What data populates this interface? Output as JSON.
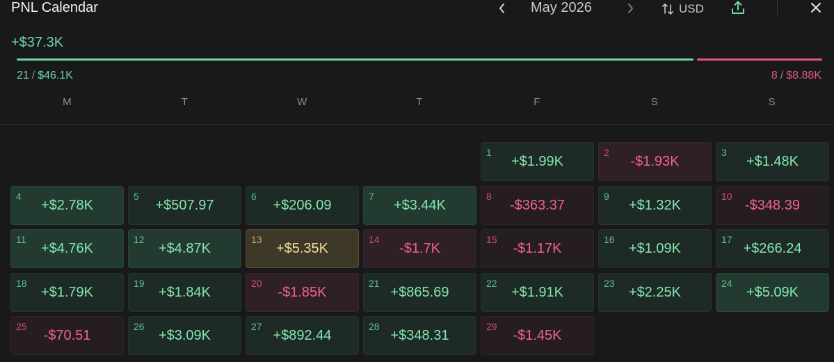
{
  "header": {
    "title": "PNL Calendar",
    "month": "May 2026",
    "currency": "USD"
  },
  "colors": {
    "profit": "#84e6b0",
    "loss": "#f0628e",
    "best_day": "#f3dfa0",
    "background": "#19191b"
  },
  "summary": {
    "total": "+$37.3K",
    "win_days": "21",
    "win_amount": "$46.1K",
    "loss_days": "8",
    "loss_amount": "$8.88K",
    "win_share": 0.84,
    "separator": "/"
  },
  "weekdays": [
    "M",
    "T",
    "W",
    "T",
    "F",
    "S",
    "S"
  ],
  "days": [
    {
      "day": "1",
      "value": "+$1.99K",
      "kind": "g1"
    },
    {
      "day": "2",
      "value": "-$1.93K",
      "kind": "r2"
    },
    {
      "day": "3",
      "value": "+$1.48K",
      "kind": "g1"
    },
    {
      "day": "4",
      "value": "+$2.78K",
      "kind": "g2"
    },
    {
      "day": "5",
      "value": "+$507.97",
      "kind": "g1"
    },
    {
      "day": "6",
      "value": "+$206.09",
      "kind": "g1"
    },
    {
      "day": "7",
      "value": "+$3.44K",
      "kind": "g2"
    },
    {
      "day": "8",
      "value": "-$363.37",
      "kind": "r1"
    },
    {
      "day": "9",
      "value": "+$1.32K",
      "kind": "g1"
    },
    {
      "day": "10",
      "value": "-$348.39",
      "kind": "r1"
    },
    {
      "day": "11",
      "value": "+$4.76K",
      "kind": "g2"
    },
    {
      "day": "12",
      "value": "+$4.87K",
      "kind": "g2"
    },
    {
      "day": "13",
      "value": "+$5.35K",
      "kind": "best"
    },
    {
      "day": "14",
      "value": "-$1.7K",
      "kind": "r2"
    },
    {
      "day": "15",
      "value": "-$1.17K",
      "kind": "r1"
    },
    {
      "day": "16",
      "value": "+$1.09K",
      "kind": "g1"
    },
    {
      "day": "17",
      "value": "+$266.24",
      "kind": "g1"
    },
    {
      "day": "18",
      "value": "+$1.79K",
      "kind": "g1"
    },
    {
      "day": "19",
      "value": "+$1.84K",
      "kind": "g1"
    },
    {
      "day": "20",
      "value": "-$1.85K",
      "kind": "r2"
    },
    {
      "day": "21",
      "value": "+$865.69",
      "kind": "g1"
    },
    {
      "day": "22",
      "value": "+$1.91K",
      "kind": "g1"
    },
    {
      "day": "23",
      "value": "+$2.25K",
      "kind": "g1"
    },
    {
      "day": "24",
      "value": "+$5.09K",
      "kind": "g2"
    },
    {
      "day": "25",
      "value": "-$70.51",
      "kind": "r1"
    },
    {
      "day": "26",
      "value": "+$3.09K",
      "kind": "g1"
    },
    {
      "day": "27",
      "value": "+$892.44",
      "kind": "g1"
    },
    {
      "day": "28",
      "value": "+$348.31",
      "kind": "g1"
    },
    {
      "day": "29",
      "value": "-$1.45K",
      "kind": "r1"
    }
  ]
}
